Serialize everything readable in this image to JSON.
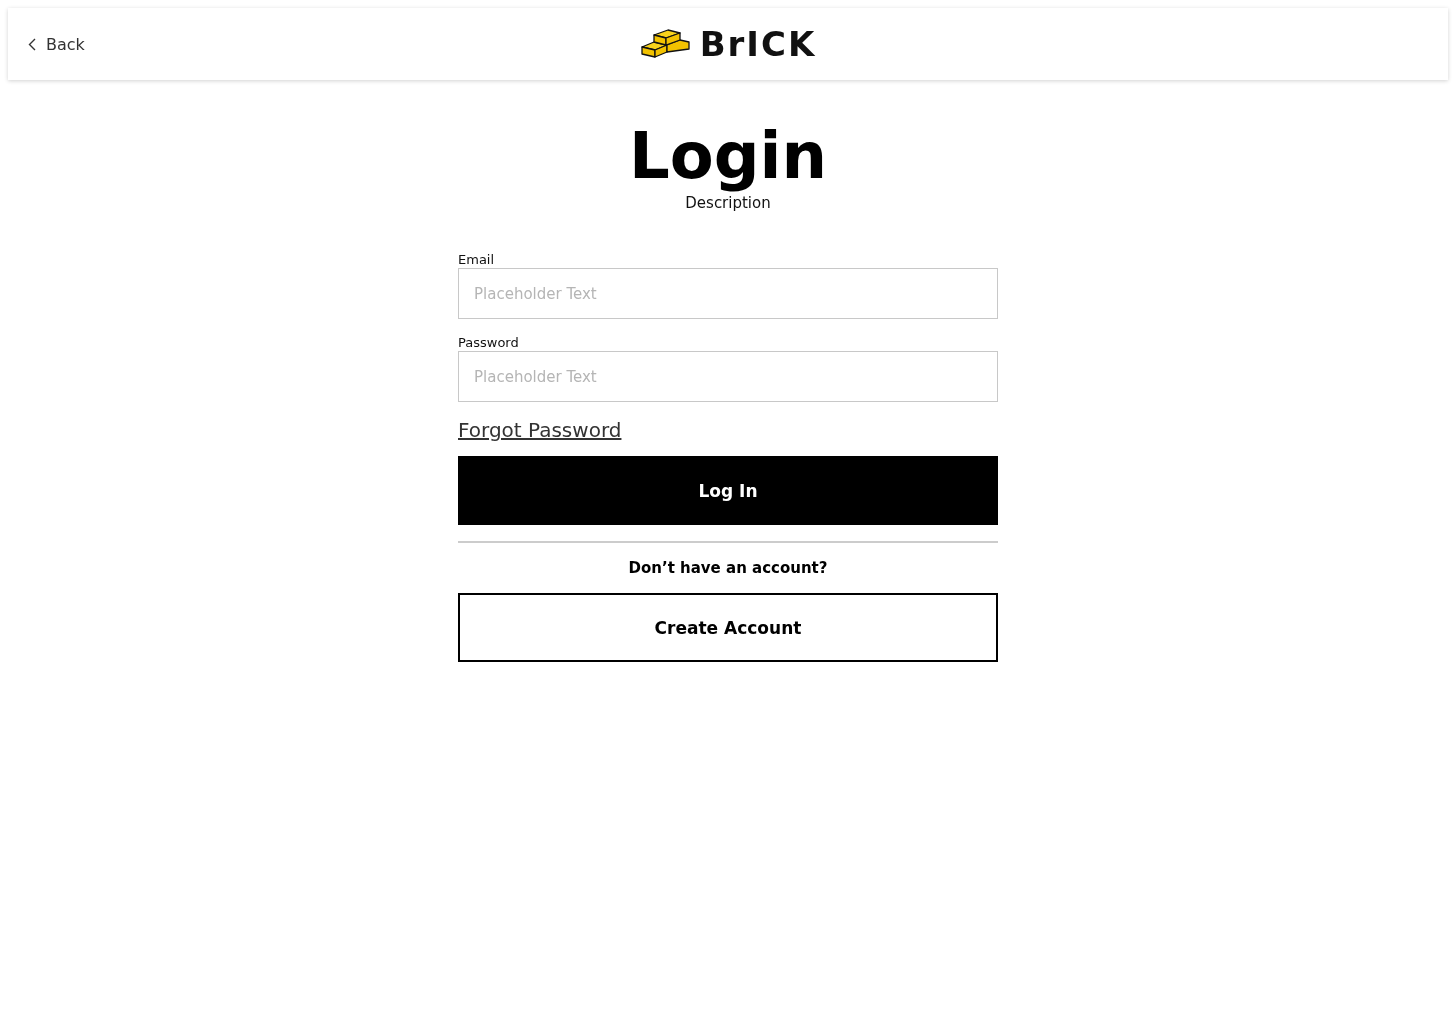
{
  "header": {
    "back_label": "Back",
    "logo_text": "BrICK"
  },
  "title": "Login",
  "description": "Description",
  "fields": [
    {
      "label": "Email",
      "placeholder": "Placeholder Text"
    },
    {
      "label": "Password",
      "placeholder": "Placeholder Text"
    }
  ],
  "forgot_link": "Forgot Password",
  "login_button": "Log In",
  "signup_prompt": "Don’t have an account?",
  "create_button": "Create Account"
}
